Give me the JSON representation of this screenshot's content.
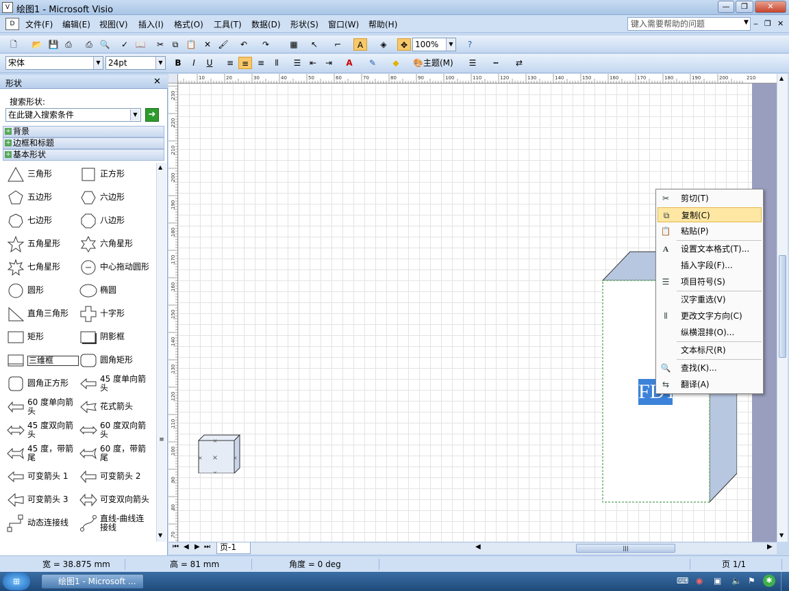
{
  "window": {
    "title": "绘图1 - Microsoft Visio",
    "app_icon": "visio-app-icon"
  },
  "menu": {
    "items": [
      "文件(F)",
      "编辑(E)",
      "视图(V)",
      "插入(I)",
      "格式(O)",
      "工具(T)",
      "数据(D)",
      "形状(S)",
      "窗口(W)",
      "帮助(H)"
    ],
    "help_placeholder": "键入需要帮助的问题"
  },
  "toolbar": {
    "zoom": "100%",
    "font": "宋体",
    "font_size": "24pt",
    "theme_label": "主题(M)"
  },
  "shapes_pane": {
    "title": "形状",
    "search_label": "搜索形状:",
    "search_placeholder": "在此键入搜索条件",
    "stencils": [
      "背景",
      "边框和标题",
      "基本形状"
    ],
    "shapes": [
      "三角形",
      "正方形",
      "五边形",
      "六边形",
      "七边形",
      "八边形",
      "五角星形",
      "六角星形",
      "七角星形",
      "中心拖动圆形",
      "圆形",
      "椭圆",
      "直角三角形",
      "十字形",
      "矩形",
      "阴影框",
      "三维框",
      "圆角矩形",
      "圆角正方形",
      "45 度单向箭头",
      "60 度单向箭头",
      "花式箭头",
      "45 度双向箭头",
      "60 度双向箭头",
      "45 度，带箭尾",
      "60 度，带箭尾",
      "可变箭头 1",
      "可变箭头 2",
      "可变箭头 3",
      "可变双向箭头",
      "动态连接线",
      "直线-曲线连接线"
    ]
  },
  "ruler": {
    "h_ticks": [
      "10",
      "20",
      "30",
      "40",
      "50",
      "60",
      "70",
      "80",
      "90",
      "100",
      "110",
      "120",
      "130",
      "140",
      "150",
      "160",
      "170",
      "180",
      "190",
      "200",
      "210"
    ],
    "v_ticks": [
      "230",
      "220",
      "210",
      "200",
      "190",
      "180",
      "170",
      "160",
      "150",
      "140",
      "130",
      "120",
      "110",
      "100",
      "90",
      "80",
      "70"
    ]
  },
  "drawing": {
    "selected_text": "FDT"
  },
  "context_menu": {
    "items": [
      {
        "label": "剪切(T)",
        "icon": "scissors-icon"
      },
      {
        "label": "复制(C)",
        "icon": "copy-icon",
        "highlighted": true
      },
      {
        "label": "粘贴(P)",
        "icon": "paste-icon"
      },
      {
        "label": "设置文本格式(T)...",
        "icon": "text-format-icon"
      },
      {
        "label": "插入字段(F)...",
        "icon": ""
      },
      {
        "label": "项目符号(S)",
        "icon": "bullets-icon"
      },
      {
        "label": "汉字重选(V)",
        "icon": ""
      },
      {
        "label": "更改文字方向(C)",
        "icon": "text-direction-icon"
      },
      {
        "label": "纵横混排(O)...",
        "icon": ""
      },
      {
        "label": "文本标尺(R)",
        "icon": ""
      },
      {
        "label": "查找(K)...",
        "icon": "find-icon"
      },
      {
        "label": "翻译(A)",
        "icon": "translate-icon"
      }
    ]
  },
  "tabs": {
    "page": "页-1"
  },
  "status": {
    "width": "宽 = 38.875 mm",
    "height": "高 = 81 mm",
    "angle": "角度 = 0 deg",
    "page": "页 1/1"
  },
  "taskbar": {
    "task": "绘图1 - Microsoft ..."
  },
  "colors": {
    "cube_face": "#b7c7e0",
    "highlight": "#fde7a3",
    "selection": "#3b82d8"
  }
}
